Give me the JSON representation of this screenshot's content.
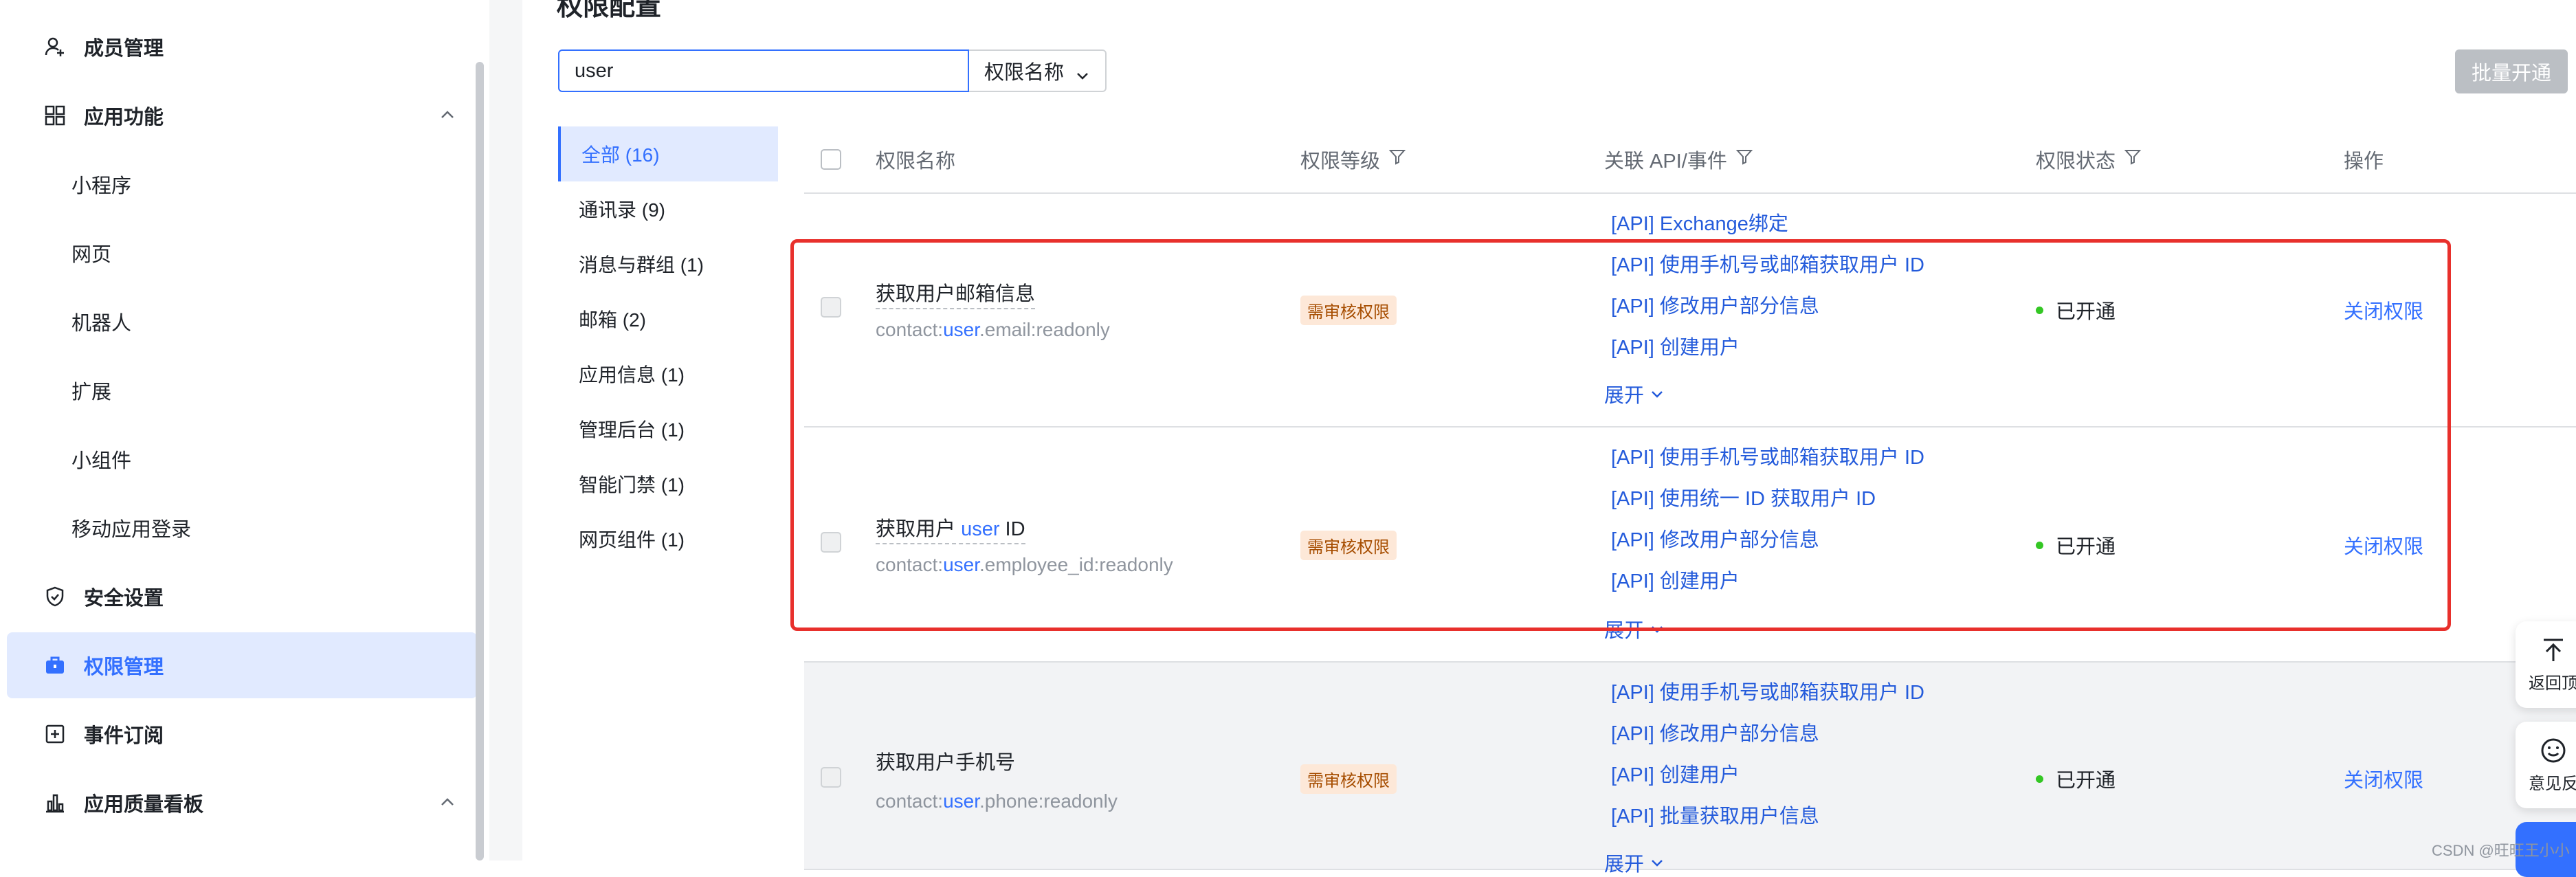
{
  "sidebar": {
    "items": [
      {
        "label": "成员管理",
        "icon": "add-user-icon",
        "type": "top",
        "active": false
      },
      {
        "label": "应用功能",
        "icon": "grid-icon",
        "type": "top",
        "active": false,
        "expanded": true
      },
      {
        "label": "小程序",
        "type": "sub"
      },
      {
        "label": "网页",
        "type": "sub"
      },
      {
        "label": "机器人",
        "type": "sub"
      },
      {
        "label": "扩展",
        "type": "sub"
      },
      {
        "label": "小组件",
        "type": "sub"
      },
      {
        "label": "移动应用登录",
        "type": "sub"
      },
      {
        "label": "安全设置",
        "icon": "shield-icon",
        "type": "top",
        "active": false
      },
      {
        "label": "权限管理",
        "icon": "briefcase-icon",
        "type": "top",
        "active": true
      },
      {
        "label": "事件订阅",
        "icon": "event-icon",
        "type": "top",
        "active": false
      },
      {
        "label": "应用质量看板",
        "icon": "bar-chart-icon",
        "type": "top",
        "active": false,
        "expanded": true
      }
    ]
  },
  "page": {
    "title": "权限配置"
  },
  "search": {
    "value": "user",
    "field_select": "权限名称"
  },
  "toolbar": {
    "batch_label": "批量开通"
  },
  "categories": [
    {
      "label": "全部 (16)",
      "active": true
    },
    {
      "label": "通讯录 (9)"
    },
    {
      "label": "消息与群组 (1)"
    },
    {
      "label": "邮箱 (2)"
    },
    {
      "label": "应用信息 (1)"
    },
    {
      "label": "管理后台 (1)"
    },
    {
      "label": "智能门禁 (1)"
    },
    {
      "label": "网页组件 (1)"
    }
  ],
  "table": {
    "headers": {
      "name": "权限名称",
      "level": "权限等级",
      "api": "关联 API/事件",
      "status": "权限状态",
      "op": "操作"
    },
    "prev_row_api": "[API] Exchange绑定",
    "rows": [
      {
        "name": "获取用户邮箱信息",
        "code_prefix": "contact:",
        "code_hl": "user",
        "code_suffix": ".email:readonly",
        "level": "需审核权限",
        "apis": [
          "[API] 使用手机号或邮箱获取用户 ID",
          "[API] 修改用户部分信息",
          "[API] 创建用户"
        ],
        "expand": "展开",
        "status": "已开通",
        "op": "关闭权限"
      },
      {
        "name_prefix": "获取用户 ",
        "name_hl": "user",
        "name_suffix": " ID",
        "code_prefix": "contact:",
        "code_hl": "user",
        "code_suffix": ".employee_id:readonly",
        "level": "需审核权限",
        "apis": [
          "[API] 使用手机号或邮箱获取用户 ID",
          "[API] 使用统一 ID 获取用户 ID",
          "[API] 修改用户部分信息",
          "[API] 创建用户"
        ],
        "expand": "展开",
        "status": "已开通",
        "op": "关闭权限"
      },
      {
        "name": "获取用户手机号",
        "code_prefix": "contact:",
        "code_hl": "user",
        "code_suffix": ".phone:readonly",
        "level": "需审核权限",
        "apis": [
          "[API] 使用手机号或邮箱获取用户 ID",
          "[API] 修改用户部分信息",
          "[API] 创建用户",
          "[API] 批量获取用户信息"
        ],
        "expand": "展开",
        "status": "已开通",
        "op": "关闭权限"
      }
    ]
  },
  "float": {
    "back_top": "返回顶",
    "feedback": "意见反"
  },
  "watermark": "CSDN @旺旺王小小"
}
